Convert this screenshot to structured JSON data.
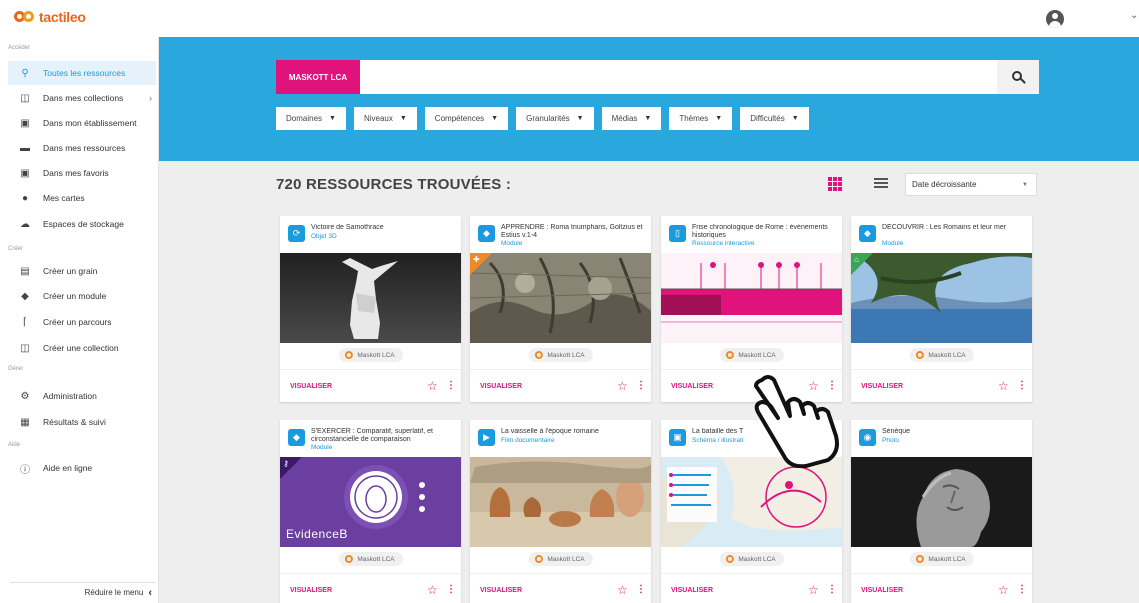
{
  "app": {
    "logo": "tactileo"
  },
  "sidebar": {
    "sections": [
      {
        "label": "Accéder"
      },
      {
        "label": "Créer"
      },
      {
        "label": "Gérer"
      },
      {
        "label": "Aide"
      }
    ],
    "items": [
      {
        "label": "Toutes les ressources",
        "icon": "search-icon"
      },
      {
        "label": "Dans mes collections",
        "icon": "collection-icon"
      },
      {
        "label": "Dans mon établissement",
        "icon": "school-icon"
      },
      {
        "label": "Dans mes ressources",
        "icon": "folder-icon"
      },
      {
        "label": "Dans mes favoris",
        "icon": "favorites-icon"
      },
      {
        "label": "Mes cartes",
        "icon": "map-pin-icon"
      },
      {
        "label": "Espaces de stockage",
        "icon": "cloud-icon"
      },
      {
        "label": "Créer un grain",
        "icon": "grain-icon"
      },
      {
        "label": "Créer un module",
        "icon": "module-icon"
      },
      {
        "label": "Créer un parcours",
        "icon": "path-icon"
      },
      {
        "label": "Créer une collection",
        "icon": "collection-icon"
      },
      {
        "label": "Administration",
        "icon": "gear-icon"
      },
      {
        "label": "Résultats & suivi",
        "icon": "chart-icon"
      },
      {
        "label": "Aide en ligne",
        "icon": "help-icon"
      }
    ],
    "reduce_label": "Réduire le menu",
    "reduce_icon": "chevron-left-icon"
  },
  "search": {
    "tag": "MASKOTT LCA",
    "value": "",
    "placeholder": ""
  },
  "filters": [
    "Domaines",
    "Niveaux",
    "Compétences",
    "Granularités",
    "Médias",
    "Thèmes",
    "Difficultés"
  ],
  "results": {
    "title": "720 RESSOURCES TROUVÉES :",
    "sort": "Date décroissante"
  },
  "colors": {
    "accent": "#e0127c",
    "primary": "#2aa8de",
    "link": "#1a9be0"
  },
  "cards": [
    {
      "title": "Victoire de Samothrace",
      "type": "Objet 3D",
      "source": "Maskott LCA",
      "action": "VISUALISER",
      "icon": "3d-object-icon"
    },
    {
      "title": "APPRENDRE : Roma triumphans, Goltzius et Estius v.1-4",
      "type": "Module",
      "source": "Maskott LCA",
      "action": "VISUALISER",
      "icon": "module-icon"
    },
    {
      "title": "Frise chronologique de Rome : événements historiques",
      "type": "Ressource interactive",
      "source": "Maskott LCA",
      "action": "VISUALISER",
      "icon": "mouse-icon"
    },
    {
      "title": "DÉCOUVRIR : Les Romains et leur mer",
      "type": "Module",
      "source": "Maskott LCA",
      "action": "VISUALISER",
      "icon": "module-icon"
    },
    {
      "title": "S'EXERCER : Comparatif, superlatif, et circonstancielle de comparaison",
      "type": "Module",
      "source": "Maskott LCA",
      "action": "VISUALISER",
      "icon": "module-icon",
      "thumb_text": "EvidenceB"
    },
    {
      "title": "La vaisselle à l'époque romaine",
      "type": "Film documentaire",
      "source": "Maskott LCA",
      "action": "VISUALISER",
      "icon": "video-icon"
    },
    {
      "title": "La bataille des T",
      "type": "Schéma / illustrati",
      "source": "Maskott LCA",
      "action": "VISUALISER",
      "icon": "schema-icon"
    },
    {
      "title": "Sénèque",
      "type": "Photo",
      "source": "Maskott LCA",
      "action": "VISUALISER",
      "icon": "photo-icon"
    }
  ]
}
